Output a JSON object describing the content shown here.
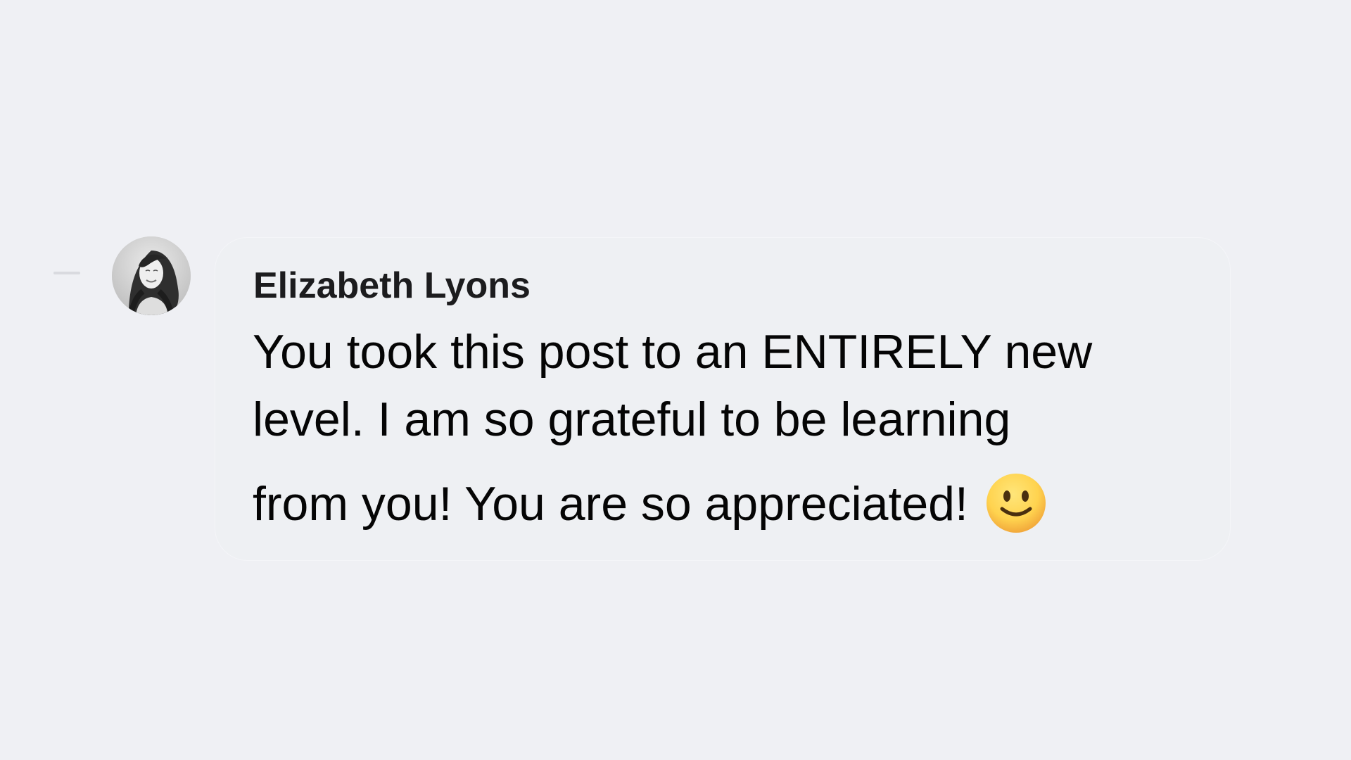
{
  "comment": {
    "author": "Elizabeth Lyons",
    "text_lines": [
      "You took this post to an ENTIRELY new",
      "level. I am so grateful to be learning",
      "from you! You are so appreciated!"
    ],
    "emoji": "slightly-smiling-face"
  },
  "colors": {
    "background": "#eff0f4",
    "bubble": "#eef0f3",
    "text": "#050505",
    "author": "#1c1c1e",
    "emoji_fill": "#ffd34f"
  }
}
